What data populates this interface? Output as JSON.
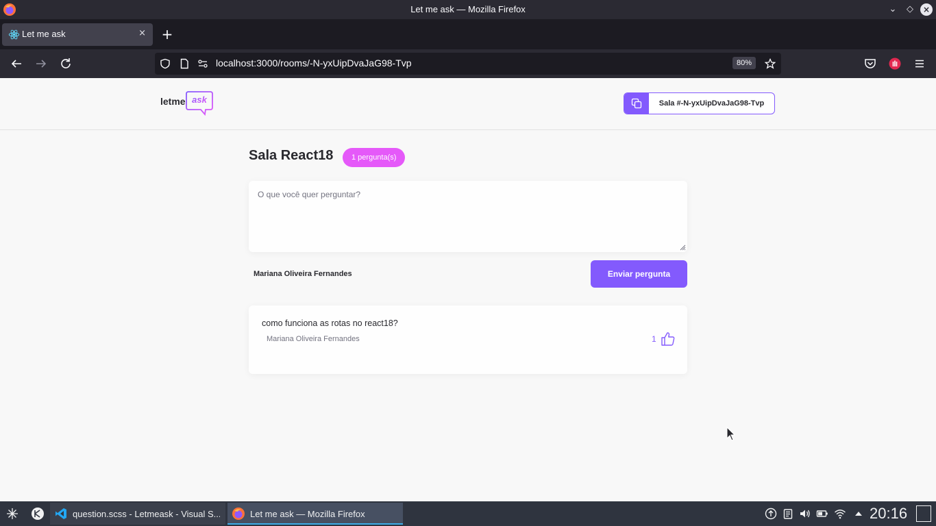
{
  "window": {
    "title": "Let me ask — Mozilla Firefox"
  },
  "browser": {
    "tab_label": "Let me ask",
    "tab_close": "×",
    "new_tab": "+",
    "url": "localhost:3000/rooms/-N-yxUipDvaJaG98-Tvp",
    "zoom": "80%"
  },
  "app": {
    "logo_text": "letme",
    "logo_bubble_text": "ask",
    "room_code_label": "Sala #-N-yxUipDvaJaG98-Tvp",
    "room_title": "Sala React18",
    "question_count": "1 pergunta(s)",
    "ask_placeholder": "O que você quer perguntar?",
    "user_name": "Mariana Oliveira Fernandes",
    "send_label": "Enviar pergunta",
    "questions": [
      {
        "content": "como funciona as rotas no react18?",
        "author": "Mariana Oliveira Fernandes",
        "likes": "1"
      }
    ],
    "colors": {
      "primary": "#835afd",
      "badge": "#e559f9",
      "text": "#29292e",
      "muted": "#737380"
    }
  },
  "taskbar": {
    "tasks": [
      {
        "label": "question.scss - Letmeask - Visual S...",
        "icon": "vscode-icon"
      },
      {
        "label": "Let me ask — Mozilla Firefox",
        "icon": "firefox-icon"
      }
    ],
    "clock": "20:16"
  }
}
